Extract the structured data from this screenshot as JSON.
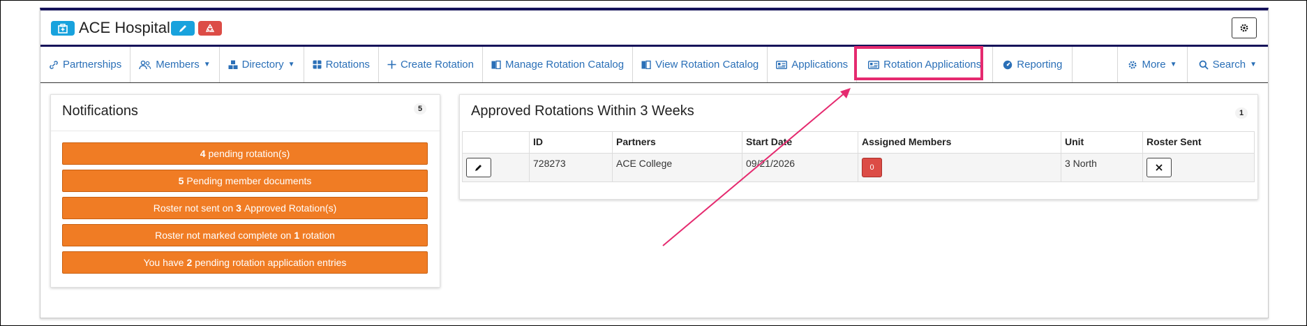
{
  "header": {
    "title": "ACE Hospital"
  },
  "nav": {
    "items": [
      {
        "label": "Partnerships",
        "icon": "link-icon"
      },
      {
        "label": "Members",
        "icon": "users-icon",
        "dropdown": true
      },
      {
        "label": "Directory",
        "icon": "cubes-icon",
        "dropdown": true
      },
      {
        "label": "Rotations",
        "icon": "grid-icon"
      },
      {
        "label": "Create Rotation",
        "icon": "plus-icon"
      },
      {
        "label": "Manage Rotation Catalog",
        "icon": "book-icon"
      },
      {
        "label": "View Rotation Catalog",
        "icon": "book-icon"
      },
      {
        "label": "Applications",
        "icon": "id-card-icon"
      },
      {
        "label": "Rotation Applications",
        "icon": "id-card-icon",
        "highlighted": true
      },
      {
        "label": "Reporting",
        "icon": "gauge-icon"
      }
    ],
    "right_items": [
      {
        "label": "More",
        "icon": "gear-icon",
        "dropdown": true
      },
      {
        "label": "Search",
        "icon": "search-icon",
        "dropdown": true
      }
    ]
  },
  "notifications": {
    "title": "Notifications",
    "count": "5",
    "items": [
      {
        "bold": "4",
        "text": "pending rotation(s)"
      },
      {
        "bold": "5",
        "text": "Pending member documents"
      },
      {
        "pre": "Roster not sent on",
        "bold": "3",
        "text": "Approved Rotation(s)"
      },
      {
        "pre": "Roster not marked complete on",
        "bold": "1",
        "text": "rotation"
      },
      {
        "pre": "You have",
        "bold": "2",
        "text": "pending rotation application entries"
      }
    ]
  },
  "rotations": {
    "title": "Approved Rotations Within 3 Weeks",
    "count": "1",
    "columns": [
      "",
      "ID",
      "Partners",
      "Start Date",
      "Assigned Members",
      "Unit",
      "Roster Sent"
    ],
    "rows": [
      {
        "id": "728273",
        "partners": "ACE College",
        "start_date": "09/21/2026",
        "assigned_members": "0",
        "unit": "3 North"
      }
    ]
  },
  "colors": {
    "accent_blue": "#18a2dd",
    "link_blue": "#2a6fb7",
    "danger_red": "#dc4c46",
    "notice_orange": "#f07c24",
    "highlight_pink": "#e52a6f",
    "header_navy": "#16135a"
  }
}
